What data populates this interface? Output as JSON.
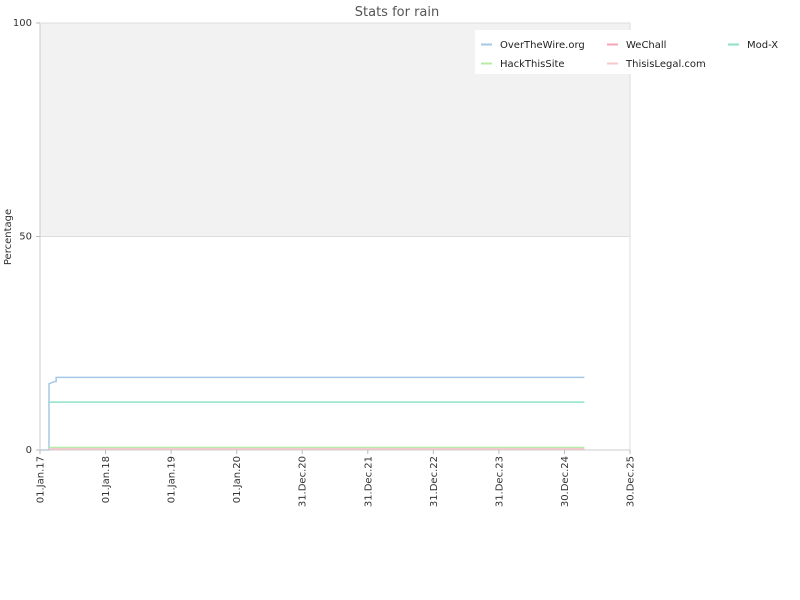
{
  "chart_data": {
    "type": "line",
    "title": "Stats for rain",
    "xlabel": "",
    "ylabel": "Percentage",
    "ylim": [
      0,
      100
    ],
    "yticks": [
      "0",
      "50",
      "100"
    ],
    "xlim": [
      "2017-01-01",
      "2025-12-30"
    ],
    "xticks": [
      {
        "date": "2017-01-01",
        "label": "01.Jan.17"
      },
      {
        "date": "2018-01-01",
        "label": "01.Jan.18"
      },
      {
        "date": "2019-01-01",
        "label": "01.Jan.19"
      },
      {
        "date": "2020-01-01",
        "label": "01.Jan.20"
      },
      {
        "date": "2020-12-31",
        "label": "31.Dec.20"
      },
      {
        "date": "2021-12-31",
        "label": "31.Dec.21"
      },
      {
        "date": "2022-12-31",
        "label": "31.Dec.22"
      },
      {
        "date": "2023-12-31",
        "label": "31.Dec.23"
      },
      {
        "date": "2024-12-30",
        "label": "30.Dec.24"
      },
      {
        "date": "2025-12-30",
        "label": "30.Dec.25"
      }
    ],
    "grid": true,
    "band": {
      "from": 50,
      "to": 100,
      "color": "#f2f2f2"
    },
    "legend": "top-right",
    "series": [
      {
        "name": "OverTheWire.org",
        "color": "#a6c8e8",
        "points": [
          {
            "x": "2017-01-01",
            "y": 0
          },
          {
            "x": "2017-02-20",
            "y": 0
          },
          {
            "x": "2017-02-20",
            "y": 15.5
          },
          {
            "x": "2017-03-20",
            "y": 16
          },
          {
            "x": "2017-04-01",
            "y": 16
          },
          {
            "x": "2017-04-01",
            "y": 17
          },
          {
            "x": "2025-04-20",
            "y": 17
          }
        ]
      },
      {
        "name": "WeChall",
        "color": "#f4a6b8",
        "points": [
          {
            "x": "2017-02-20",
            "y": 0.1
          },
          {
            "x": "2025-04-20",
            "y": 0.1
          }
        ]
      },
      {
        "name": "Mod-X",
        "color": "#8de0c8",
        "points": [
          {
            "x": "2017-02-20",
            "y": 11.2
          },
          {
            "x": "2025-04-20",
            "y": 11.2
          }
        ]
      },
      {
        "name": "HackThisSite",
        "color": "#b6eca8",
        "points": [
          {
            "x": "2017-02-20",
            "y": 0.6
          },
          {
            "x": "2025-04-20",
            "y": 0.6
          }
        ]
      },
      {
        "name": "ThisisLegal.com",
        "color": "#f8c8cc",
        "points": [
          {
            "x": "2017-02-20",
            "y": 0.3
          },
          {
            "x": "2025-04-20",
            "y": 0.3
          }
        ]
      }
    ]
  }
}
